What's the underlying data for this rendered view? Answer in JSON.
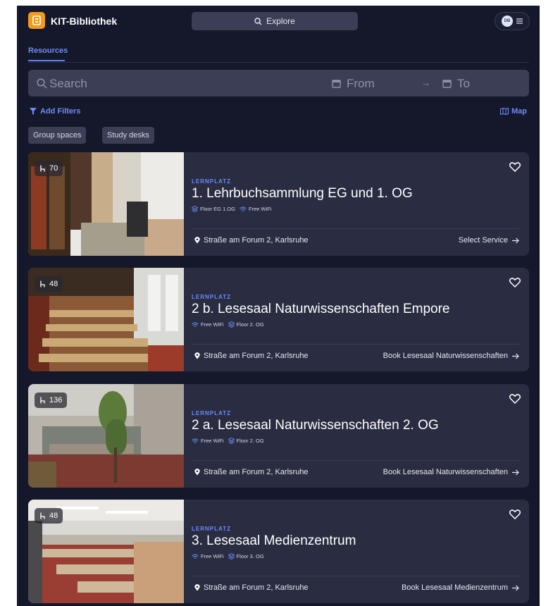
{
  "header": {
    "logo_text": "KIT-Bibliothek",
    "explore_label": "Explore",
    "avatar_initials": "DB"
  },
  "tabs": [
    {
      "label": "Resources",
      "active": true
    }
  ],
  "search": {
    "placeholder": "Search",
    "from_label": "From",
    "to_label": "To",
    "arrow": "→"
  },
  "filters": {
    "add_label": "Add Filters",
    "map_label": "Map"
  },
  "chips": [
    "Group spaces",
    "Study desks"
  ],
  "cards": [
    {
      "seats": "70",
      "kind": "LERNPLATZ",
      "title": "1. Lehrbuchsammlung EG und 1. OG",
      "tags": [
        "Floor EG 1.OG",
        "Free WiFi"
      ],
      "address": "Straße am Forum 2, Karlsruhe",
      "cta": "Select Service"
    },
    {
      "seats": "48",
      "kind": "LERNPLATZ",
      "title": "2 b. Lesesaal Naturwissenschaften Empore",
      "tags": [
        "Free WiFi",
        "Floor 2. OG"
      ],
      "address": "Straße am Forum 2, Karlsruhe",
      "cta": "Book Lesesaal Naturwissenschaften"
    },
    {
      "seats": "136",
      "kind": "LERNPLATZ",
      "title": "2 a. Lesesaal Naturwissenschaften 2. OG",
      "tags": [
        "Free WiFi",
        "Floor 2. OG"
      ],
      "address": "Straße am Forum 2, Karlsruhe",
      "cta": "Book Lesesaal Naturwissenschaften"
    },
    {
      "seats": "48",
      "kind": "LERNPLATZ",
      "title": "3. Lesesaal Medienzentrum",
      "tags": [
        "Free WiFi",
        "Floor 3. OG"
      ],
      "address": "Straße am Forum 2, Karlsruhe",
      "cta": "Book Lesesaal Medienzentrum"
    }
  ],
  "colors": {
    "background": "#15172a",
    "card": "#2a2c41",
    "accent": "#6b8df7",
    "logo": "#f29a1c",
    "input": "#3b3e55"
  }
}
